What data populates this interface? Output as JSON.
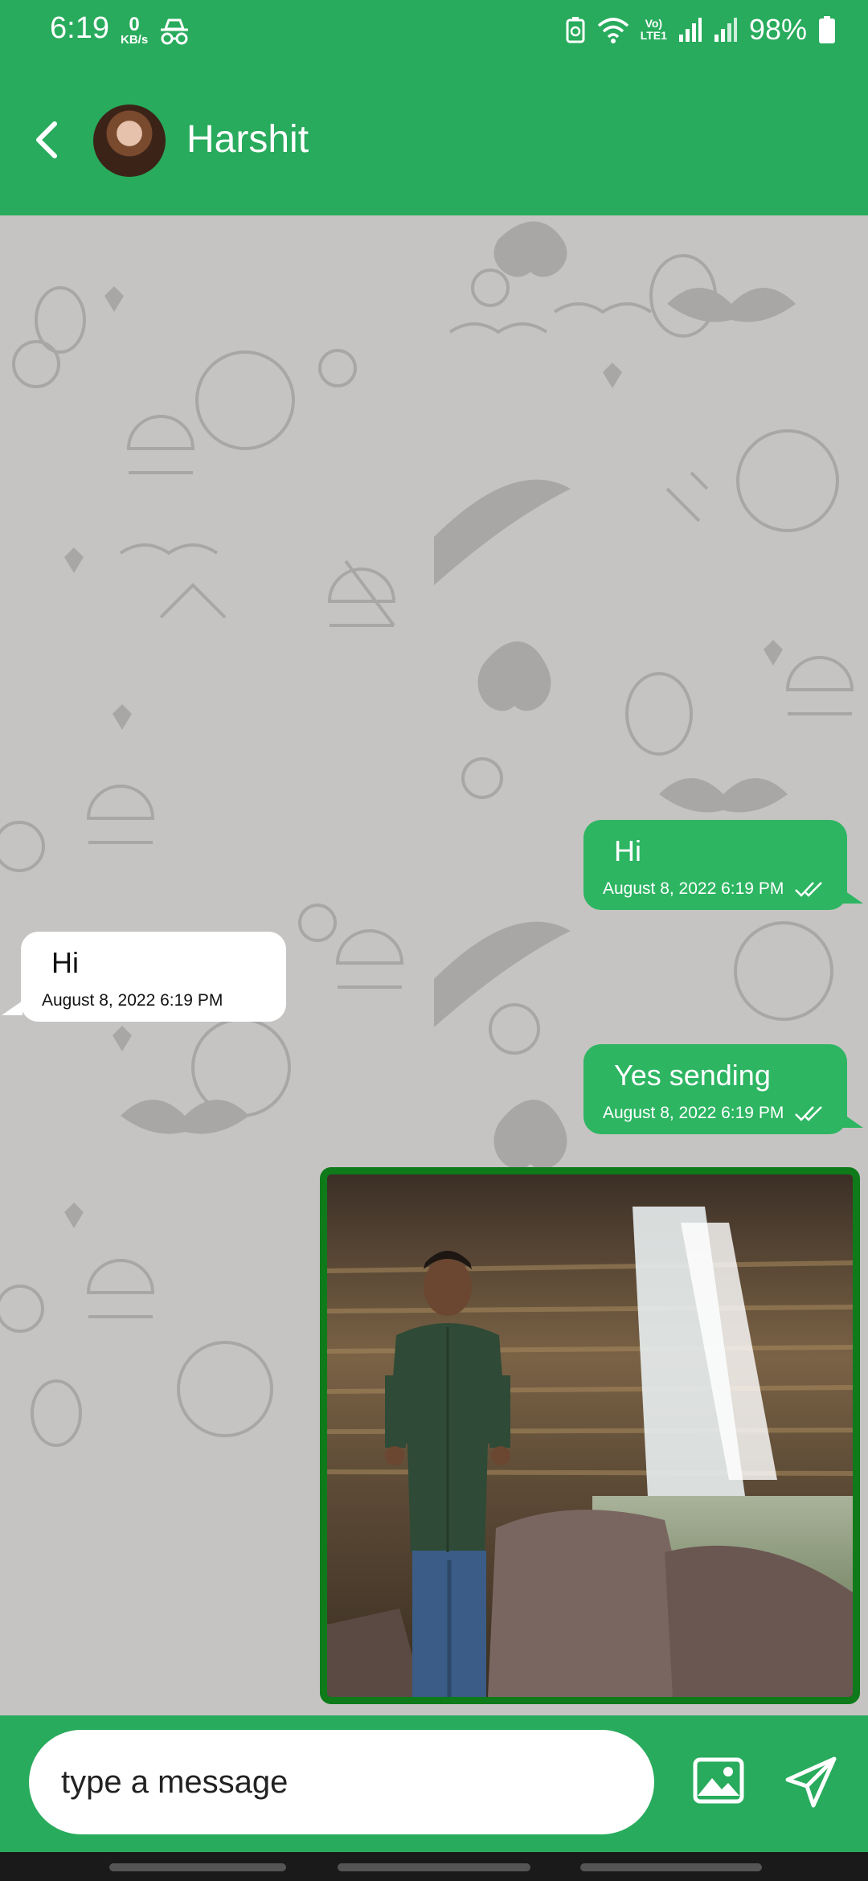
{
  "status_bar": {
    "time": "6:19",
    "speed_value": "0",
    "speed_unit": "KB/s",
    "volte_line1": "Vo)",
    "volte_line2": "LTE1",
    "battery": "98%"
  },
  "header": {
    "contact_name": "Harshit"
  },
  "messages": [
    {
      "direction": "out",
      "text": "Hi",
      "time": "August 8, 2022 6:19 PM"
    },
    {
      "direction": "in",
      "text": "Hi",
      "time": "August 8, 2022 6:19 PM"
    },
    {
      "direction": "out",
      "text": "Yes sending",
      "time": "August 8, 2022 6:19 PM"
    }
  ],
  "composer": {
    "placeholder": "type a message"
  },
  "colors": {
    "brand_green": "#28ab5c",
    "outgoing_bubble": "#2db562",
    "photo_border": "#0e7a1a",
    "chat_background": "#c6c4c2"
  }
}
